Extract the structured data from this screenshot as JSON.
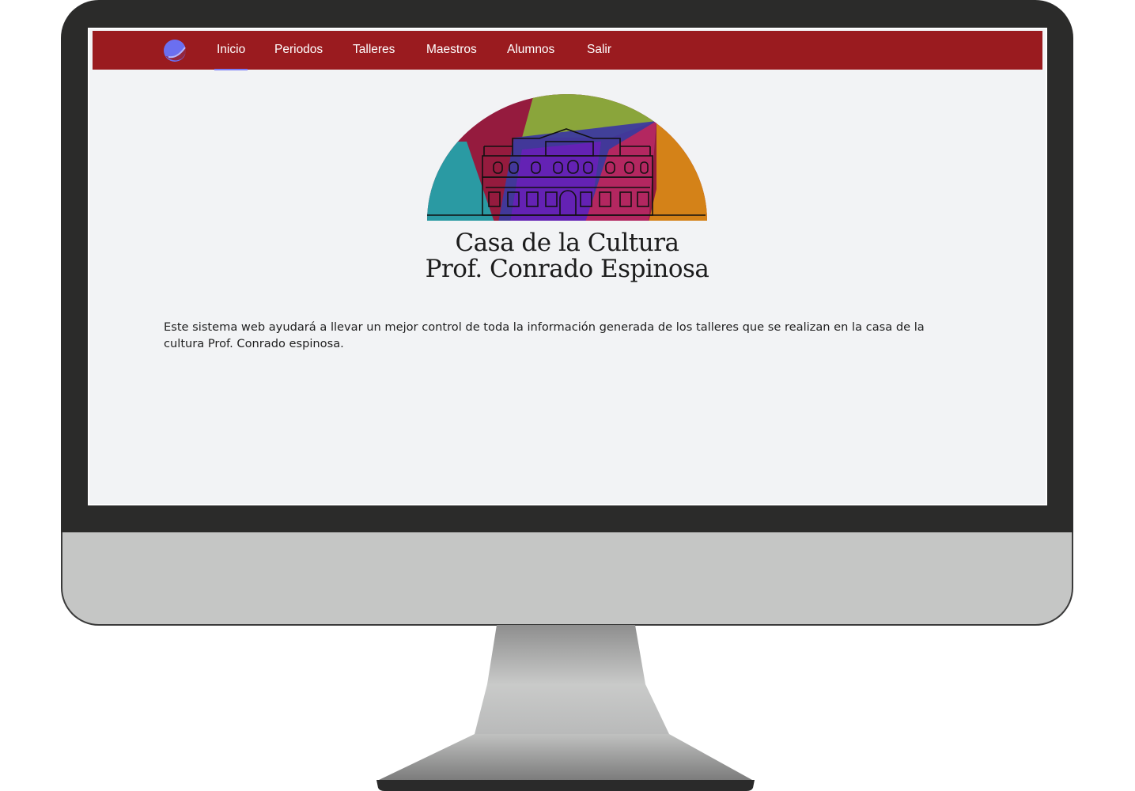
{
  "nav": {
    "logo_icon": "planet-logo-icon",
    "items": [
      {
        "label": "Inicio",
        "active": true
      },
      {
        "label": "Periodos",
        "active": false
      },
      {
        "label": "Talleres",
        "active": false
      },
      {
        "label": "Maestros",
        "active": false
      },
      {
        "label": "Alumnos",
        "active": false
      },
      {
        "label": "Salir",
        "active": false
      }
    ]
  },
  "brand": {
    "title_line1": "Casa de la Cultura",
    "title_line2": "Prof. Conrado Espinosa",
    "logo_colors": [
      "#2a9aa3",
      "#951b3e",
      "#8aa53b",
      "#3d3a9e",
      "#d48218",
      "#6a1fb8",
      "#c0265a"
    ]
  },
  "intro_text": "Este sistema web ayudará a llevar un mejor control de toda la información generada de los talleres que se realizan en la casa de la cultura Prof. Conrado espinosa.",
  "colors": {
    "navbar": "#9a1b1f",
    "active_underline": "#7c7ef5",
    "page_bg": "#f2f3f5",
    "monitor_frame": "#2b2b2a",
    "monitor_chin": "#c5c6c5"
  }
}
